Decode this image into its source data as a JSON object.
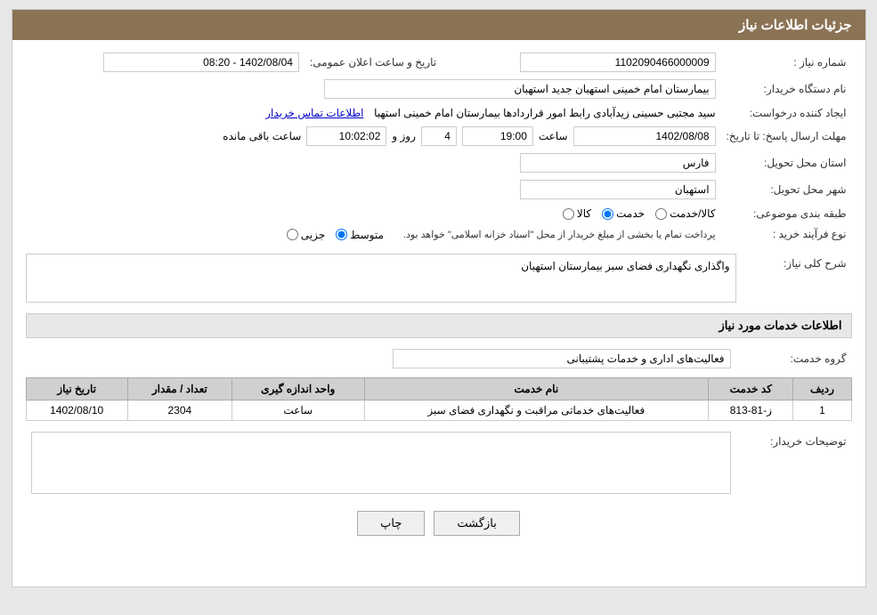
{
  "header": {
    "title": "جزئیات اطلاعات نیاز"
  },
  "fields": {
    "need_number_label": "شماره نیاز :",
    "need_number_value": "1102090466000009",
    "buyer_name_label": "نام دستگاه خریدار:",
    "buyer_name_value": "بیمارستان امام خمینی استهبان جدید استهبان",
    "creator_label": "ایجاد کننده درخواست:",
    "creator_name": "سید مجتبی حسینی زیدآبادی رابط امور قراردادها بیمارستان امام خمینی استهبا",
    "creator_link": "اطلاعات تماس خریدار",
    "deadline_label": "مهلت ارسال پاسخ: تا تاریخ:",
    "pub_date_label": "تاریخ و ساعت اعلان عمومی:",
    "pub_date_value": "1402/08/04 - 08:20",
    "deadline_date": "1402/08/08",
    "deadline_time": "19:00",
    "deadline_days": "4",
    "deadline_remaining": "10:02:02",
    "deadline_days_label": "روز و",
    "deadline_remaining_label": "ساعت باقی مانده",
    "province_label": "استان محل تحویل:",
    "province_value": "فارس",
    "city_label": "شهر محل تحویل:",
    "city_value": "استهبان",
    "category_label": "طبقه بندی موضوعی:",
    "category_options": [
      "کالا",
      "خدمت",
      "کالا/خدمت"
    ],
    "category_selected": "خدمت",
    "purchase_type_label": "نوع فرآیند خرید :",
    "purchase_type_options": [
      "جزیی",
      "متوسط"
    ],
    "purchase_type_note": "پرداخت تمام یا بخشی از مبلغ خریدار از محل \"اسناد خزانه اسلامی\" خواهد بود.",
    "purchase_type_selected": "متوسط",
    "need_description_label": "شرح کلی نیاز:",
    "need_description_value": "واگذاری نگهداری فضای سبز بیمارستان استهبان",
    "services_section_title": "اطلاعات خدمات مورد نیاز",
    "service_group_label": "گروه خدمت:",
    "service_group_value": "فعالیت‌های اداری و خدمات پشتیبانی",
    "table_headers": [
      "ردیف",
      "کد خدمت",
      "نام خدمت",
      "واحد اندازه گیری",
      "تعداد / مقدار",
      "تاریخ نیاز"
    ],
    "table_rows": [
      {
        "row": "1",
        "code": "ز-81-813",
        "name": "فعالیت‌های خدماتی مراقبت و نگهداری فضای سبز",
        "unit": "ساعت",
        "quantity": "2304",
        "date": "1402/08/10"
      }
    ],
    "buyer_desc_label": "توضیحات خریدار:",
    "buttons": {
      "print": "چاپ",
      "back": "بازگشت"
    }
  }
}
